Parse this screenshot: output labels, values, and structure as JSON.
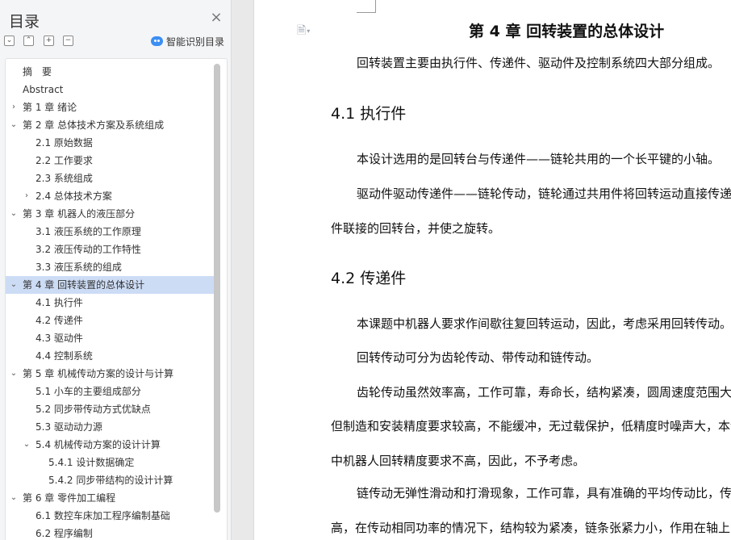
{
  "sidebar": {
    "title": "目录",
    "close_icon": "×",
    "tools": [
      "⌄",
      "⌃",
      "+",
      "−"
    ],
    "ai_label": "智能识别目录",
    "toc": [
      {
        "label": "摘　要",
        "level": 0,
        "arrow": ""
      },
      {
        "label": "Abstract",
        "level": 0,
        "arrow": ""
      },
      {
        "label": "第 1 章  绪论",
        "level": 0,
        "arrow": "›"
      },
      {
        "label": "第 2 章  总体技术方案及系统组成",
        "level": 0,
        "arrow": "⌄"
      },
      {
        "label": "2.1 原始数据",
        "level": 1,
        "arrow": ""
      },
      {
        "label": "2.2 工作要求",
        "level": 1,
        "arrow": ""
      },
      {
        "label": "2.3 系统组成",
        "level": 1,
        "arrow": ""
      },
      {
        "label": "2.4 总体技术方案",
        "level": 1,
        "arrow": "›"
      },
      {
        "label": "第 3 章  机器人的液压部分",
        "level": 0,
        "arrow": "⌄"
      },
      {
        "label": "3.1 液压系统的工作原理",
        "level": 1,
        "arrow": ""
      },
      {
        "label": "3.2 液压传动的工作特性",
        "level": 1,
        "arrow": ""
      },
      {
        "label": "3.3 液压系统的组成",
        "level": 1,
        "arrow": ""
      },
      {
        "label": "第 4 章  回转装置的总体设计",
        "level": 0,
        "arrow": "⌄",
        "selected": true
      },
      {
        "label": "4.1 执行件",
        "level": 1,
        "arrow": ""
      },
      {
        "label": "4.2 传递件",
        "level": 1,
        "arrow": ""
      },
      {
        "label": "4.3 驱动件",
        "level": 1,
        "arrow": ""
      },
      {
        "label": "4.4 控制系统",
        "level": 1,
        "arrow": ""
      },
      {
        "label": "第 5 章  机械传动方案的设计与计算",
        "level": 0,
        "arrow": "⌄"
      },
      {
        "label": "5.1 小车的主要组成部分",
        "level": 1,
        "arrow": ""
      },
      {
        "label": "5.2 同步带传动方式优缺点",
        "level": 1,
        "arrow": ""
      },
      {
        "label": "5.3 驱动动力源",
        "level": 1,
        "arrow": ""
      },
      {
        "label": "5.4 机械传动方案的设计计算",
        "level": 1,
        "arrow": "⌄"
      },
      {
        "label": "5.4.1 设计数据确定",
        "level": 2,
        "arrow": ""
      },
      {
        "label": "5.4.2 同步带结构的设计计算",
        "level": 2,
        "arrow": ""
      },
      {
        "label": "第 6 章  零件加工编程",
        "level": 0,
        "arrow": "⌄"
      },
      {
        "label": "6.1 数控车床加工程序编制基础",
        "level": 1,
        "arrow": ""
      },
      {
        "label": "6.2 程序编制",
        "level": 1,
        "arrow": ""
      }
    ]
  },
  "document": {
    "doc_icon": "🗎",
    "chapter_title": "第 4 章  回转装置的总体设计",
    "intro": "回转装置主要由执行件、传递件、驱动件及控制系统四大部分组成。",
    "h_41": "4.1 执行件",
    "p_41a": "本设计选用的是回转台与传递件——链轮共用的一个长平键的小轴。",
    "p_41b": "驱动件驱动传递件——链轮传动，链轮通过共用件将回转运动直接传递给",
    "p_41c": "件联接的回转台，并使之旋转。",
    "h_42": "4.2 传递件",
    "p_42a": "本课题中机器人要求作间歇往复回转运动，因此，考虑采用回转传动。",
    "p_42b": "回转传动可分为齿轮传动、带传动和链传动。",
    "p_42c": "齿轮传动虽然效率高，工作可靠，寿命长，结构紧凑，圆周速度范围大，",
    "p_42d": "但制造和安装精度要求较高，不能缓冲，无过载保护，低精度时噪声大，本课题",
    "p_42e": "中机器人回转精度要求不高，因此，不予考虑。",
    "p_42f": "链传动无弹性滑动和打滑现象，工作可靠，具有准确的平均传动比，传动效率",
    "p_42g": "高，在传动相同功率的情况下，结构较为紧凑，链条张紧力小，作用在轴上的"
  }
}
